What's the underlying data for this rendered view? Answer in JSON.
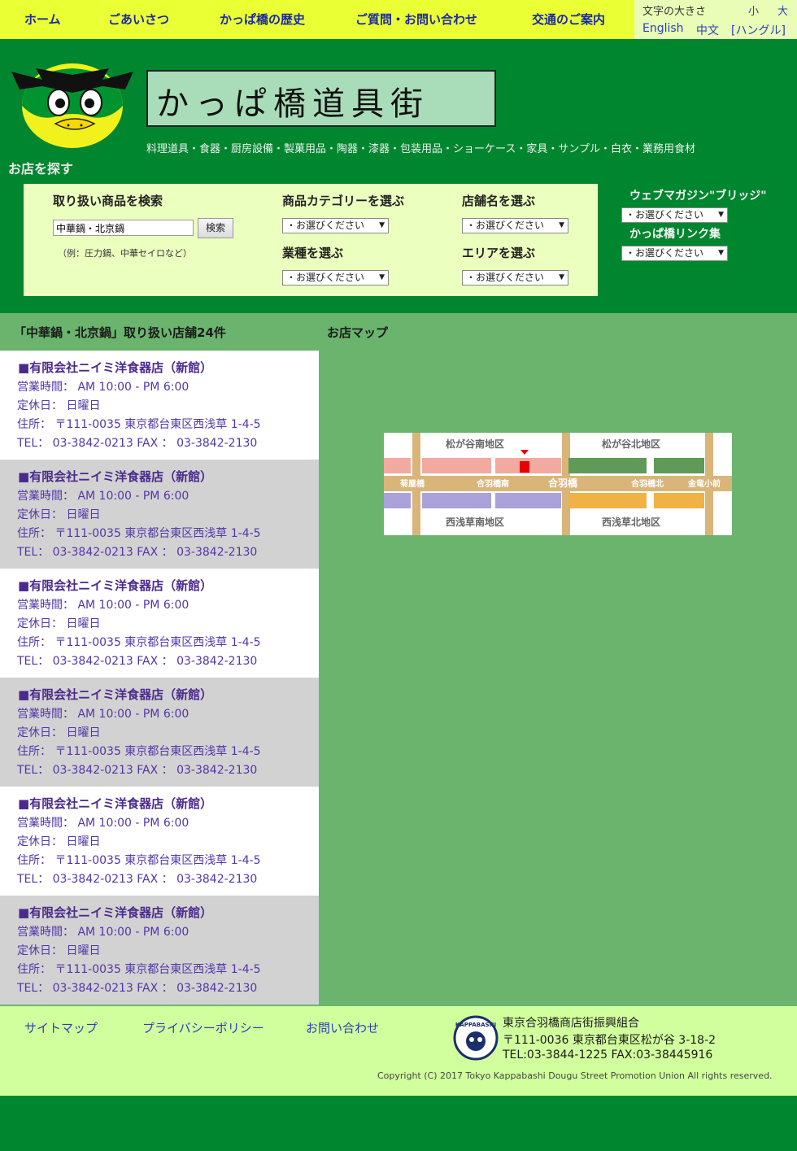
{
  "nav": {
    "home": "ホーム",
    "greeting": "ごあいさつ",
    "history": "かっぱ橋の歴史",
    "contact": "ご質問・お問い合わせ",
    "access": "交通のご案内"
  },
  "font_size": {
    "label": "文字の大きさ",
    "small": "小",
    "large": "大"
  },
  "languages": {
    "english": "English",
    "chinese": "中文",
    "korean": "[ハングル]"
  },
  "header": {
    "logo_text": "かっぱ橋道具街",
    "tagline": "料理道具・食器・厨房設備・製菓用品・陶器・漆器・包装用品・ショーケース・家具・サンプル・白衣・業務用食材",
    "search_heading": "お店を探す"
  },
  "search": {
    "product_heading": "取り扱い商品を検索",
    "product_value": "中華鍋・北京鍋",
    "button": "検索",
    "example": "（例：圧力鍋、中華セイロなど）",
    "category_heading": "商品カテゴリーを選ぶ",
    "shop_heading": "店舗名を選ぶ",
    "industry_heading": "業種を選ぶ",
    "area_heading": "エリアを選ぶ",
    "select_placeholder": "・お選びください"
  },
  "side": {
    "magazine_heading": "ウェブマガジン\"ブリッジ\"",
    "links_heading": "かっぱ橋リンク集",
    "select_placeholder": "・お選びください"
  },
  "results": {
    "count_text": "「中華鍋・北京鍋」取り扱い店舗24件",
    "map_title": "お店マップ",
    "stores": [
      {
        "name": "■有限会社ニイミ洋食器店（新館）",
        "hours": "営業時間： AM 10:00 - PM 6:00",
        "closed": "定休日： 日曜日",
        "address": "住所： 〒111-0035 東京都台東区西浅草 1-4-5",
        "tel": "TEL： 03-3842-0213 FAX ： 03-3842-2130"
      },
      {
        "name": "■有限会社ニイミ洋食器店（新館）",
        "hours": "営業時間： AM 10:00 - PM 6:00",
        "closed": "定休日： 日曜日",
        "address": "住所： 〒111-0035 東京都台東区西浅草 1-4-5",
        "tel": "TEL： 03-3842-0213 FAX ： 03-3842-2130"
      },
      {
        "name": "■有限会社ニイミ洋食器店（新館）",
        "hours": "営業時間： AM 10:00 - PM 6:00",
        "closed": "定休日： 日曜日",
        "address": "住所： 〒111-0035 東京都台東区西浅草 1-4-5",
        "tel": "TEL： 03-3842-0213 FAX ： 03-3842-2130"
      },
      {
        "name": "■有限会社ニイミ洋食器店（新館）",
        "hours": "営業時間： AM 10:00 - PM 6:00",
        "closed": "定休日： 日曜日",
        "address": "住所： 〒111-0035 東京都台東区西浅草 1-4-5",
        "tel": "TEL： 03-3842-0213 FAX ： 03-3842-2130"
      },
      {
        "name": "■有限会社ニイミ洋食器店（新館）",
        "hours": "営業時間： AM 10:00 - PM 6:00",
        "closed": "定休日： 日曜日",
        "address": "住所： 〒111-0035 東京都台東区西浅草 1-4-5",
        "tel": "TEL： 03-3842-0213 FAX ： 03-3842-2130"
      },
      {
        "name": "■有限会社ニイミ洋食器店（新館）",
        "hours": "営業時間： AM 10:00 - PM 6:00",
        "closed": "定休日： 日曜日",
        "address": "住所： 〒111-0035 東京都台東区西浅草 1-4-5",
        "tel": "TEL： 03-3842-0213 FAX ： 03-3842-2130"
      }
    ]
  },
  "map": {
    "districts": [
      "松が谷南地区",
      "松が谷北地区",
      "西浅草南地区",
      "西浅草北地区"
    ],
    "intersections": [
      "菊屋橋",
      "合羽橋南",
      "合羽橋",
      "合羽橋北",
      "金竜小前"
    ]
  },
  "footer": {
    "sitemap": "サイトマップ",
    "privacy": "プライバシーポリシー",
    "contact": "お問い合わせ",
    "org_name": "東京合羽橋商店街振興組合",
    "org_address": "〒111-0036 東京都台東区松が谷 3-18-2",
    "org_tel": "TEL:03-3844-1225 FAX:03-38445916",
    "copyright": "Copyright (C) 2017 Tokyo Kappabashi Dougu Street Promotion Union All rights reserved.",
    "seal_text": "KAPPABASHI"
  },
  "colors": {
    "background_green": "#00862f",
    "nav_yellow": "#ebff35",
    "panel_cream": "#ebffbf",
    "main_green": "#6ab46e",
    "footer_green": "#d2ff9e",
    "store_name_purple": "#4a2a8c"
  }
}
